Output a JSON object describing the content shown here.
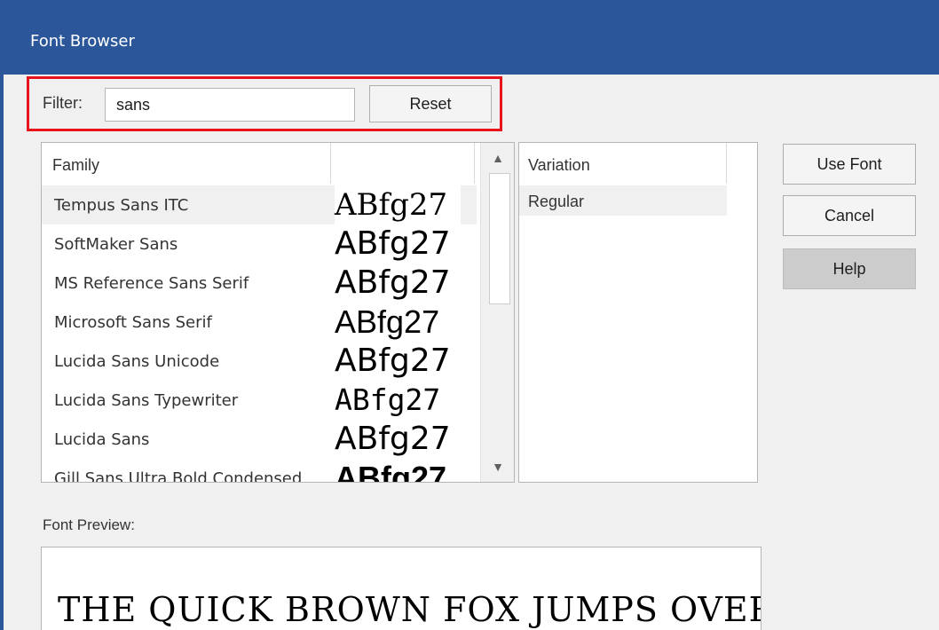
{
  "window": {
    "title": "Font Browser"
  },
  "filter": {
    "label": "Filter:",
    "value": "sans",
    "reset_label": "Reset"
  },
  "buttons": {
    "use_font": "Use Font",
    "cancel": "Cancel",
    "help": "Help"
  },
  "family_list": {
    "header": "Family",
    "sample_text": "ABfg27",
    "rows": [
      {
        "name": "Tempus Sans ITC",
        "selected": true
      },
      {
        "name": "SoftMaker Sans",
        "selected": false
      },
      {
        "name": "MS Reference Sans Serif",
        "selected": false
      },
      {
        "name": "Microsoft Sans Serif",
        "selected": false
      },
      {
        "name": "Lucida Sans Unicode",
        "selected": false
      },
      {
        "name": "Lucida Sans Typewriter",
        "selected": false
      },
      {
        "name": "Lucida Sans",
        "selected": false
      },
      {
        "name": "Gill Sans Ultra Bold Condensed",
        "selected": false
      }
    ]
  },
  "variation_list": {
    "header": "Variation",
    "items": [
      "Regular"
    ]
  },
  "preview": {
    "label": "Font Preview:",
    "text": "THE QUICK BROWN FOX JUMPS OVER THE"
  },
  "colors": {
    "titlebar": "#2b579a",
    "highlight_border": "#e8141b"
  }
}
